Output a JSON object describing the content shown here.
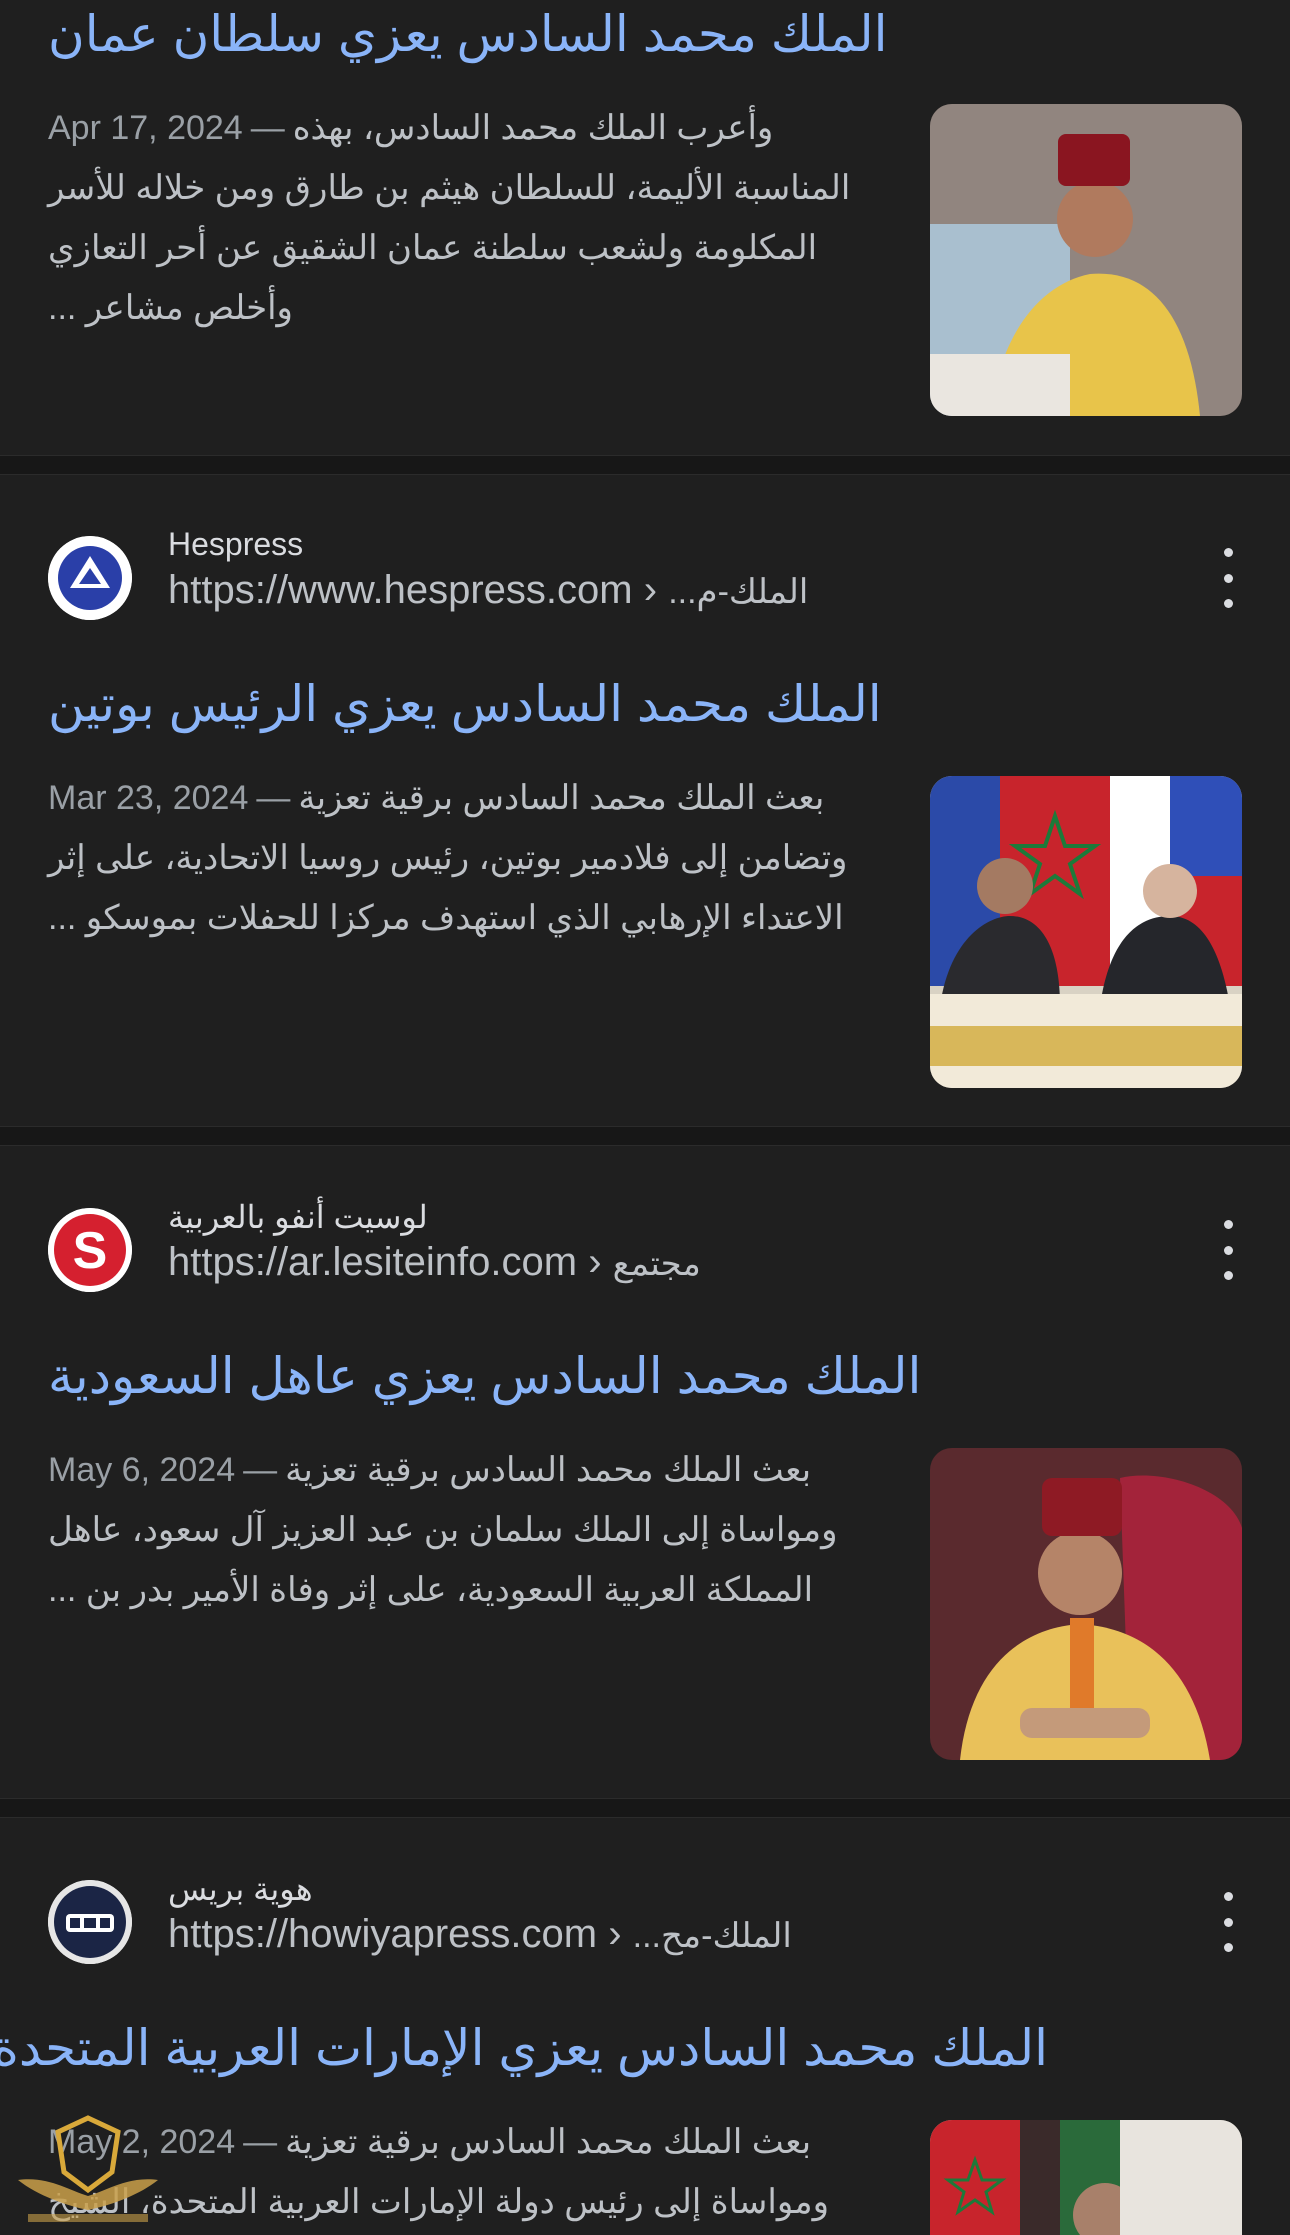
{
  "results": [
    {
      "title": "الملك محمد السادس يعزي سلطان عمان",
      "date": "Apr 17, 2024",
      "separator": "—",
      "snippet": "وأعرب الملك محمد السادس، بهذه المناسبة الأليمة، للسلطان هيثم بن طارق ومن خلاله للأسر المكلومة ولشعب سلطنة عمان الشقيق عن أحر التعازي وأخلص مشاعر ..."
    },
    {
      "source_name": "Hespress",
      "url": "https://www.hespress.com",
      "url_sep": "›",
      "url_path": "الملك-م...",
      "title": "الملك محمد السادس يعزي الرئيس بوتين",
      "date": "Mar 23, 2024",
      "separator": "—",
      "snippet": "بعث الملك محمد السادس برقية تعزية وتضامن إلى فلادمير بوتين، رئيس روسيا الاتحادية، على إثر الاعتداء الإرهابي الذي استهدف مركزا للحفلات بموسكو ..."
    },
    {
      "source_name": "لوسيت أنفو بالعربية",
      "url": "https://ar.lesiteinfo.com",
      "url_sep": "›",
      "url_path": "مجتمع",
      "title": "الملك محمد السادس يعزي عاهل السعودية",
      "date": "May 6, 2024",
      "separator": "—",
      "snippet": "بعث الملك محمد السادس برقية تعزية ومواساة إلى الملك سلمان بن عبد العزيز آل سعود، عاهل المملكة العربية السعودية، على إثر وفاة الأمير بدر بن ..."
    },
    {
      "source_name": "هوية بريس",
      "url": "https://howiyapress.com",
      "url_sep": "›",
      "url_path": "الملك-مح...",
      "title": "الملك محمد السادس يعزي الإمارات العربية المتحدة",
      "date": "May 2, 2024",
      "separator": "—",
      "snippet": "بعث الملك محمد السادس برقية تعزية ومواساة إلى رئيس دولة الإمارات العربية المتحدة، الشيخ"
    }
  ],
  "icons": {
    "hespress": "hespress-logo-icon",
    "lesiteinfo": "lesiteinfo-s-logo-icon",
    "howiyapress": "howiyapress-logo-icon",
    "more": "more-vert-icon"
  },
  "colors": {
    "background": "#1f1f1f",
    "title_link": "#8ab4f8",
    "text": "#bdc1c6"
  }
}
